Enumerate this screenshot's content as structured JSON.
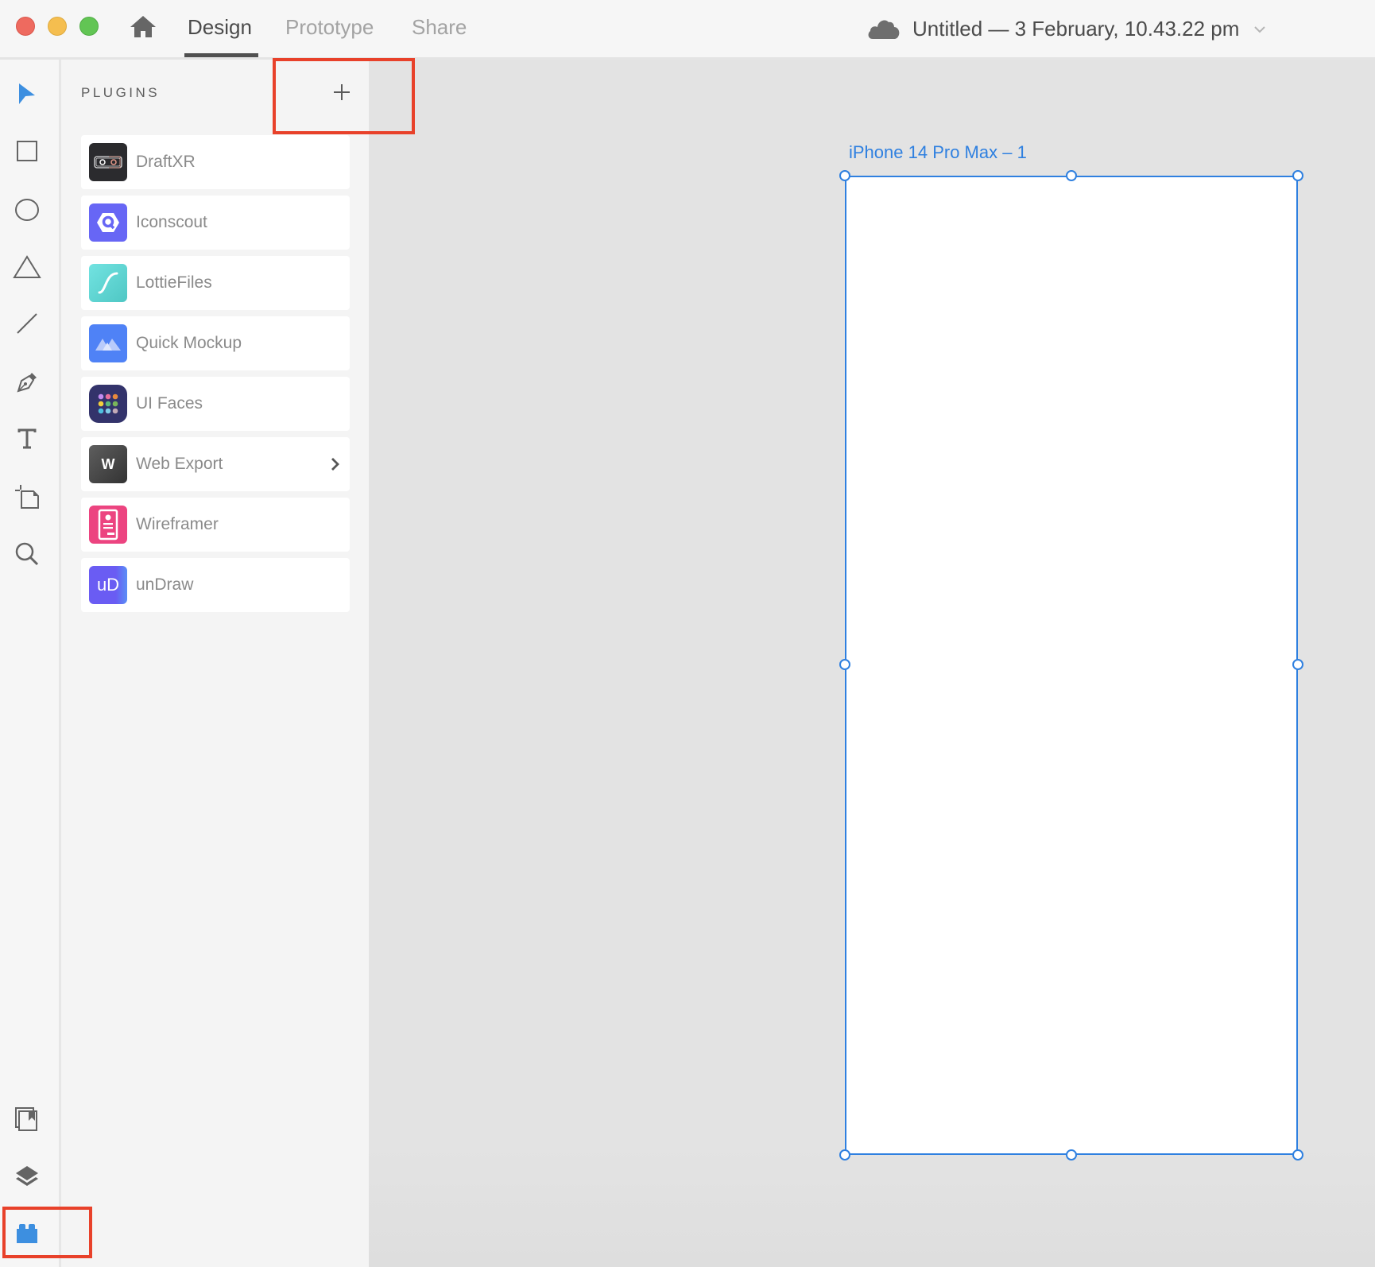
{
  "window": {
    "controls": [
      "close",
      "minimize",
      "maximize"
    ]
  },
  "topbar": {
    "home_icon": "home-icon",
    "tabs": [
      {
        "label": "Design",
        "active": true
      },
      {
        "label": "Prototype",
        "active": false
      },
      {
        "label": "Share",
        "active": false
      }
    ],
    "document_title": "Untitled — 3 February, 10.43.22 pm",
    "cloud_icon": "cloud-icon"
  },
  "toolbar": {
    "tools": [
      {
        "name": "select",
        "icon": "pointer-icon",
        "active": true
      },
      {
        "name": "rectangle",
        "icon": "rectangle-icon"
      },
      {
        "name": "ellipse",
        "icon": "ellipse-icon"
      },
      {
        "name": "polygon",
        "icon": "triangle-icon"
      },
      {
        "name": "line",
        "icon": "line-icon"
      },
      {
        "name": "pen",
        "icon": "pen-icon"
      },
      {
        "name": "text",
        "icon": "text-icon"
      },
      {
        "name": "artboard",
        "icon": "artboard-icon"
      },
      {
        "name": "zoom",
        "icon": "search-icon"
      }
    ],
    "bottom": [
      {
        "name": "assets",
        "icon": "assets-icon"
      },
      {
        "name": "layers",
        "icon": "layers-icon"
      },
      {
        "name": "plugins",
        "icon": "plugins-icon",
        "active": true
      }
    ]
  },
  "plugins_panel": {
    "title": "PLUGINS",
    "add_label": "+",
    "items": [
      {
        "name": "DraftXR",
        "icon_color": "#2b2b2e"
      },
      {
        "name": "Iconscout",
        "icon_color": "#6766f5"
      },
      {
        "name": "LottieFiles",
        "icon_color": "#5fd6d3"
      },
      {
        "name": "Quick Mockup",
        "icon_color": "#4f82f6"
      },
      {
        "name": "UI Faces",
        "icon_color": "#33336b"
      },
      {
        "name": "Web Export",
        "icon_color": "#4a4a4a",
        "icon_letter": "W",
        "has_submenu": true
      },
      {
        "name": "Wireframer",
        "icon_color": "#ec4480"
      },
      {
        "name": "unDraw",
        "icon_color": "#6a5cf3",
        "icon_letter": "uD"
      }
    ]
  },
  "canvas": {
    "artboard_label": "iPhone 14 Pro Max – 1",
    "selection_color": "#2f80e0"
  },
  "annotations": {
    "highlight_color": "#e8412a"
  }
}
